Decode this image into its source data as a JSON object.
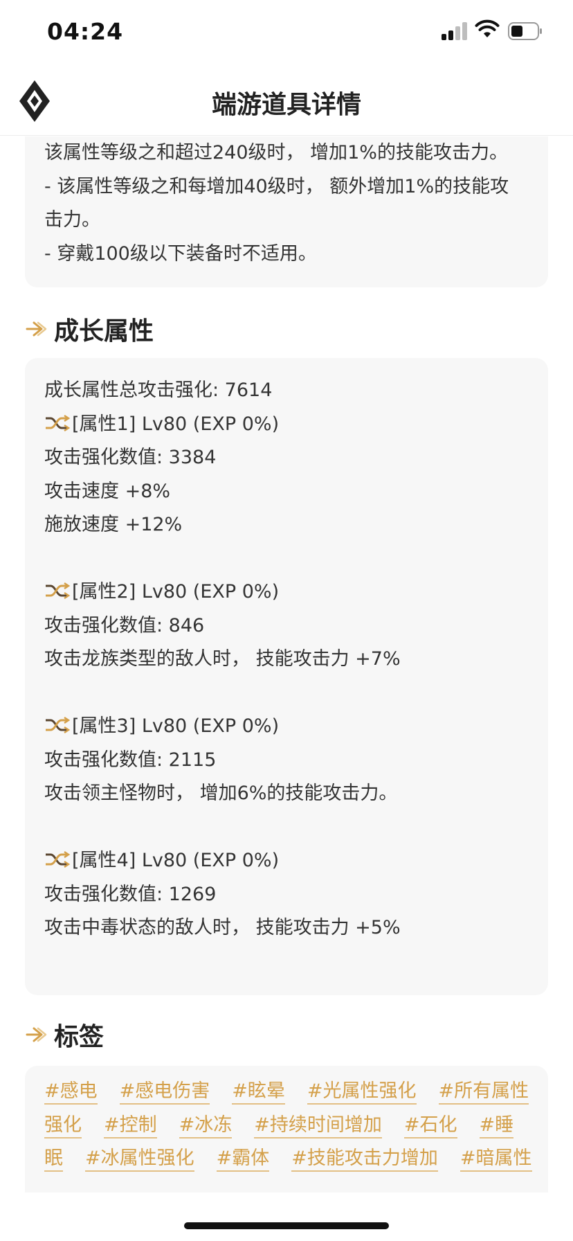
{
  "status_bar": {
    "time": "04:24"
  },
  "header": {
    "title": "端游道具详情"
  },
  "top_card": {
    "lines": [
      "该属性等级之和超过240级时， 增加1%的技能攻击力。",
      "- 该属性等级之和每增加40级时， 额外增加1%的技能攻",
      "击力。",
      "- 穿戴100级以下装备时不适用。"
    ]
  },
  "growth_section": {
    "title": "成长属性",
    "total": "成长属性总攻击强化: 7614",
    "attrs": [
      {
        "header": "[属性1] Lv80 (EXP 0%)",
        "lines": [
          "攻击强化数值:  3384",
          "攻击速度 +8%",
          "施放速度 +12%"
        ]
      },
      {
        "header": "[属性2] Lv80 (EXP 0%)",
        "lines": [
          "攻击强化数值:  846",
          "攻击龙族类型的敌人时， 技能攻击力 +7%"
        ]
      },
      {
        "header": "[属性3] Lv80 (EXP 0%)",
        "lines": [
          "攻击强化数值:  2115",
          "攻击领主怪物时， 增加6%的技能攻击力。"
        ]
      },
      {
        "header": "[属性4] Lv80 (EXP 0%)",
        "lines": [
          "攻击强化数值:  1269",
          "攻击中毒状态的敌人时， 技能攻击力 +5%"
        ]
      }
    ]
  },
  "tags_section": {
    "title": "标签",
    "rows": [
      [
        "#感电",
        "#感电伤害",
        "#眩晕",
        "#光属性强化",
        "#所有属性"
      ],
      [
        "强化",
        "#控制",
        "#冰冻",
        "#持续时间增加",
        "#石化",
        "#睡"
      ],
      [
        "眠",
        "#冰属性强化",
        "#霸体",
        "#技能攻击力增加",
        "#暗属性"
      ]
    ]
  },
  "colors": {
    "accent": "#d4a04a",
    "card_bg": "#f7f7f7"
  }
}
